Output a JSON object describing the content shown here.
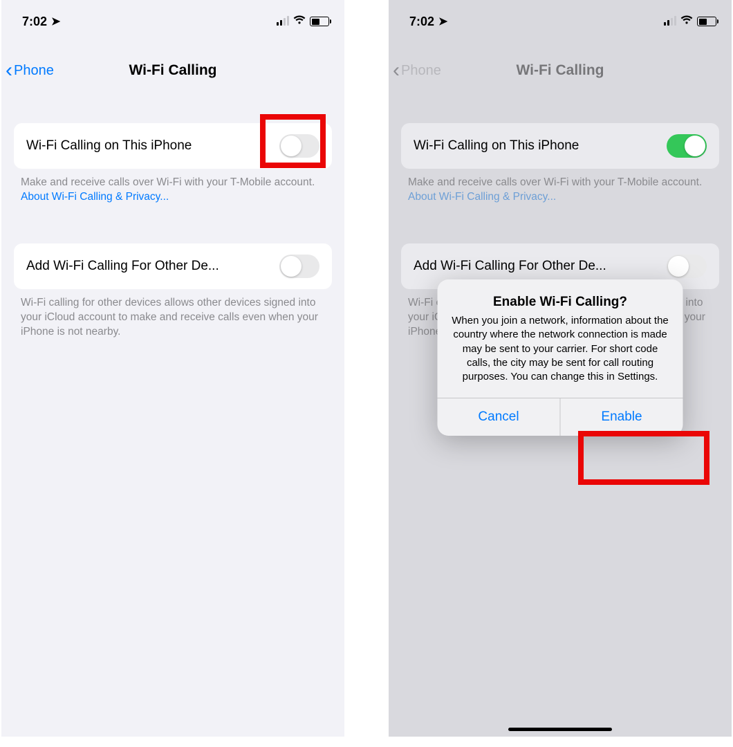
{
  "status": {
    "time": "7:02"
  },
  "nav": {
    "back": "Phone",
    "title": "Wi-Fi Calling"
  },
  "rows": {
    "this_iphone": "Wi-Fi Calling on This iPhone",
    "other_devices": "Add Wi-Fi Calling For Other De..."
  },
  "footers": {
    "main_a": "Make and receive calls over Wi-Fi with your T-Mobile account. ",
    "main_link": "About Wi-Fi Calling & Privacy...",
    "other_full": "Wi-Fi calling for other devices allows other devices signed into your iCloud account to make and receive calls even when your iPhone is not nearby.",
    "other_cut": "Wi-Fi calling for other devices allows other devices signed into your iCloud account to make and receive calls even when your iPhone is not nearby."
  },
  "alert": {
    "title": "Enable Wi-Fi Calling?",
    "body": "When you join a network, information about the country where the network connection is made may be sent to your carrier. For short code calls, the city may be sent for call routing purposes. You can change this in Settings.",
    "cancel": "Cancel",
    "enable": "Enable"
  }
}
